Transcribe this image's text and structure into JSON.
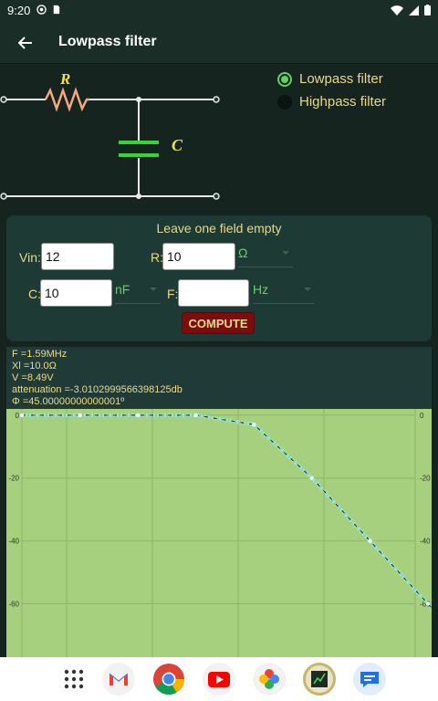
{
  "status": {
    "time": "9:20"
  },
  "app": {
    "title": "Lowpass filter"
  },
  "circuit": {
    "r_label": "R",
    "c_label": "C"
  },
  "filters": {
    "lowpass_label": "Lowpass filter",
    "highpass_label": "Highpass filter",
    "selected": "lowpass"
  },
  "form": {
    "hint": "Leave one field empty",
    "vin_label": "Vin:",
    "vin_value": "12",
    "r_label": "R:",
    "r_value": "10",
    "r_unit": "Ω",
    "c_label": "C:",
    "c_value": "10",
    "c_unit": "nF",
    "f_label": "F:",
    "f_value": "",
    "f_unit": "Hz",
    "compute_label": "COMPUTE"
  },
  "results": {
    "line1": "F =1.59MHz",
    "line2": "Xl =10.0Ω",
    "line3": "V =8.49V",
    "line4": "attenuation =-3.0102999566398125db",
    "line5": "Φ =45.00000000000001º"
  },
  "chart_data": {
    "type": "line",
    "series": [
      {
        "values_db_at_decade": [
          0,
          0,
          0,
          0,
          -3,
          -20,
          -40,
          -60,
          -80
        ]
      }
    ],
    "y_ticks": [
      "0",
      "-20",
      "-40",
      "-60"
    ],
    "ylim": [
      -77,
      2
    ],
    "grid": true
  },
  "dock": [
    "apps",
    "gmail",
    "chrome",
    "youtube",
    "photos",
    "app-icon",
    "messages"
  ]
}
